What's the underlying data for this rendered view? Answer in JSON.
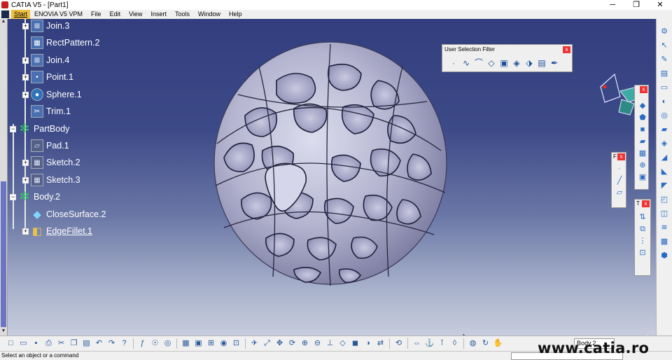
{
  "window": {
    "title": "CATIA V5 - [Part1]",
    "controls": [
      "─",
      "❐",
      "✕"
    ]
  },
  "menu": {
    "start": "Start",
    "items": [
      "ENOVIA V5 VPM",
      "File",
      "Edit",
      "View",
      "Insert",
      "Tools",
      "Window",
      "Help"
    ]
  },
  "tree": {
    "items": [
      {
        "label": "Join.3",
        "icon": "join-icon",
        "expander": "+"
      },
      {
        "label": "RectPattern.2",
        "icon": "rect-pattern-icon",
        "expander": ""
      },
      {
        "label": "Join.4",
        "icon": "join-icon",
        "expander": "+"
      },
      {
        "label": "Point.1",
        "icon": "point-icon",
        "expander": "+"
      },
      {
        "label": "Sphere.1",
        "icon": "sphere-icon",
        "expander": "+"
      },
      {
        "label": "Trim.1",
        "icon": "trim-icon",
        "expander": ""
      },
      {
        "label": "PartBody",
        "icon": "body-gear-icon",
        "expander": "−"
      },
      {
        "label": "Pad.1",
        "icon": "pad-icon",
        "expander": ""
      },
      {
        "label": "Sketch.2",
        "icon": "sketch-icon",
        "expander": "+"
      },
      {
        "label": "Sketch.3",
        "icon": "sketch-icon",
        "expander": "+"
      },
      {
        "label": "Body.2",
        "icon": "body-gear-icon",
        "expander": "−"
      },
      {
        "label": "CloseSurface.2",
        "icon": "close-surface-icon",
        "expander": ""
      },
      {
        "label": "EdgeFillet.1",
        "icon": "edge-fillet-icon",
        "expander": "+"
      }
    ]
  },
  "user_selection_filter": {
    "title": "User Selection Filter",
    "close": "x",
    "buttons": [
      "point-filter-icon",
      "curve-filter-icon",
      "surface-filter-icon",
      "volume-filter-icon",
      "feature-filter-icon",
      "geometry-filter-icon",
      "quick-select-icon",
      "trap-icon",
      "tool-palette-icon"
    ]
  },
  "floating_toolbars": {
    "a": {
      "caption": "",
      "close": "x"
    },
    "b": {
      "caption": "F",
      "close": "x"
    },
    "c": {
      "caption": "T",
      "close": "x"
    }
  },
  "toolbar": {
    "body_combo": "Body.2"
  },
  "status": {
    "text": "Select an object or a command"
  },
  "watermark": "www.catia.ro",
  "colors": {
    "viewport_top": "#323e7e",
    "viewport_bottom": "#c7cddd",
    "part_surface": "#b8b8d4",
    "tree_text": "#ffffff",
    "close_button": "#ee3333"
  }
}
